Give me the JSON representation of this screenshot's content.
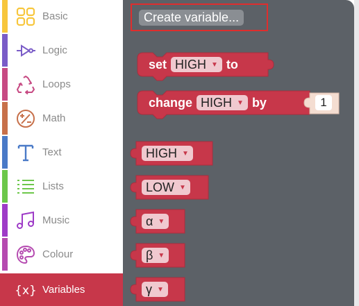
{
  "categories": [
    {
      "label": "Basic",
      "color": "#f7c63c",
      "icon": "grid-icon"
    },
    {
      "label": "Logic",
      "color": "#7a5cc7",
      "icon": "logic-gate-icon"
    },
    {
      "label": "Loops",
      "color": "#c74a83",
      "icon": "recycle-icon"
    },
    {
      "label": "Math",
      "color": "#c7704a",
      "icon": "math-ops-icon"
    },
    {
      "label": "Text",
      "color": "#4a7ac7",
      "icon": "text-t-icon"
    },
    {
      "label": "Lists",
      "color": "#6cc74a",
      "icon": "list-icon"
    },
    {
      "label": "Music",
      "color": "#9e3bc7",
      "icon": "music-note-icon"
    },
    {
      "label": "Colour",
      "color": "#b54ab0",
      "icon": "palette-icon"
    },
    {
      "label": "Variables",
      "color": "#c7374a",
      "icon": "variable-braces-icon"
    }
  ],
  "selected_category": "Variables",
  "flyout": {
    "create_button": "Create variable...",
    "set_block": {
      "word": "set",
      "variable": "HIGH",
      "to": "to"
    },
    "change_block": {
      "word": "change",
      "variable": "HIGH",
      "by": "by",
      "amount": "1"
    },
    "variable_getters": [
      "HIGH",
      "LOW",
      "α",
      "β",
      "γ"
    ]
  },
  "colors": {
    "block": "#c7374a",
    "flyout_bg": "#5c6167",
    "highlight": "#e02d2d"
  }
}
